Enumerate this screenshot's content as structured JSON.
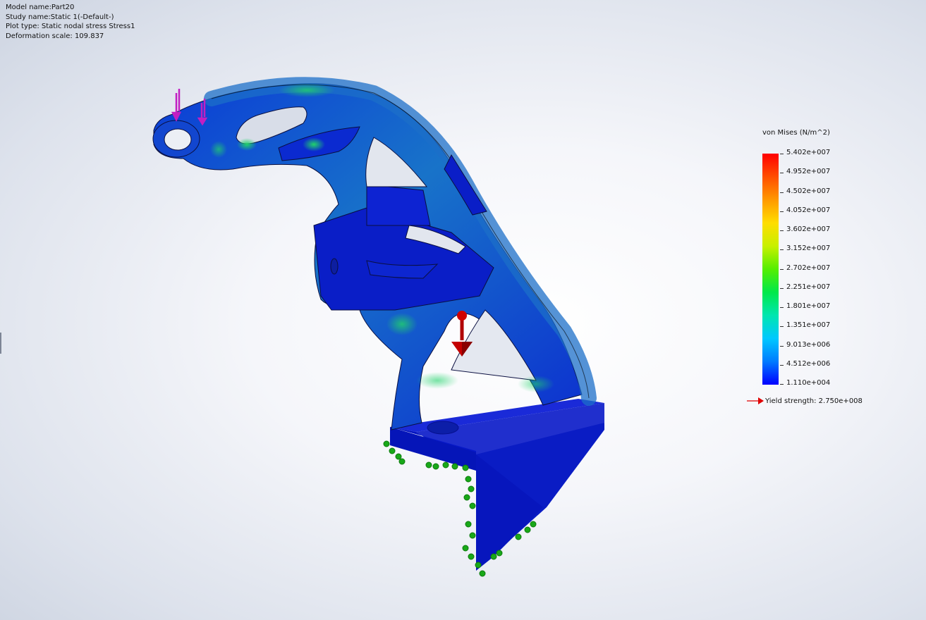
{
  "info": {
    "model_name": "Model name:Part20",
    "study_name": "Study name:Static 1(-Default-)",
    "plot_type": "Plot type: Static nodal stress Stress1",
    "deformation_scale": "Deformation scale: 109.837"
  },
  "legend": {
    "title": "von Mises (N/m^2)",
    "ticks": [
      "5.402e+007",
      "4.952e+007",
      "4.502e+007",
      "4.052e+007",
      "3.602e+007",
      "3.152e+007",
      "2.702e+007",
      "2.251e+007",
      "1.801e+007",
      "1.351e+007",
      "9.013e+006",
      "4.512e+006",
      "1.110e+004"
    ],
    "yield_strength": "Yield strength: 2.750e+008"
  },
  "colors": {
    "part_blue": "#0a1fc8",
    "load_arrow": "#c21fc2",
    "force_marker": "#c40000",
    "fixture_marker": "#19a819",
    "yield_arrow": "#e00000"
  },
  "icons": {
    "load": "load-arrow-icon",
    "force": "force-cone-icon",
    "fixture": "fixed-support-icon"
  }
}
